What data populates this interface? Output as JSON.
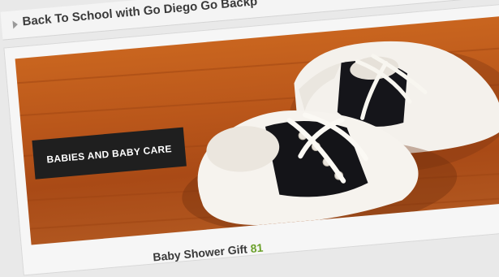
{
  "top_article": {
    "title": "Back To School with Go Diego Go Backp"
  },
  "featured": {
    "category_label": "BABIES AND BABY CARE",
    "photo": "baby-saddle-shoes-photo"
  },
  "bottom_article": {
    "title": "Baby Shower Gift",
    "count": "81"
  },
  "colors": {
    "badge_bg": "#1f1f1f",
    "count_green": "#6aa02a",
    "wood": "#b9561a"
  }
}
